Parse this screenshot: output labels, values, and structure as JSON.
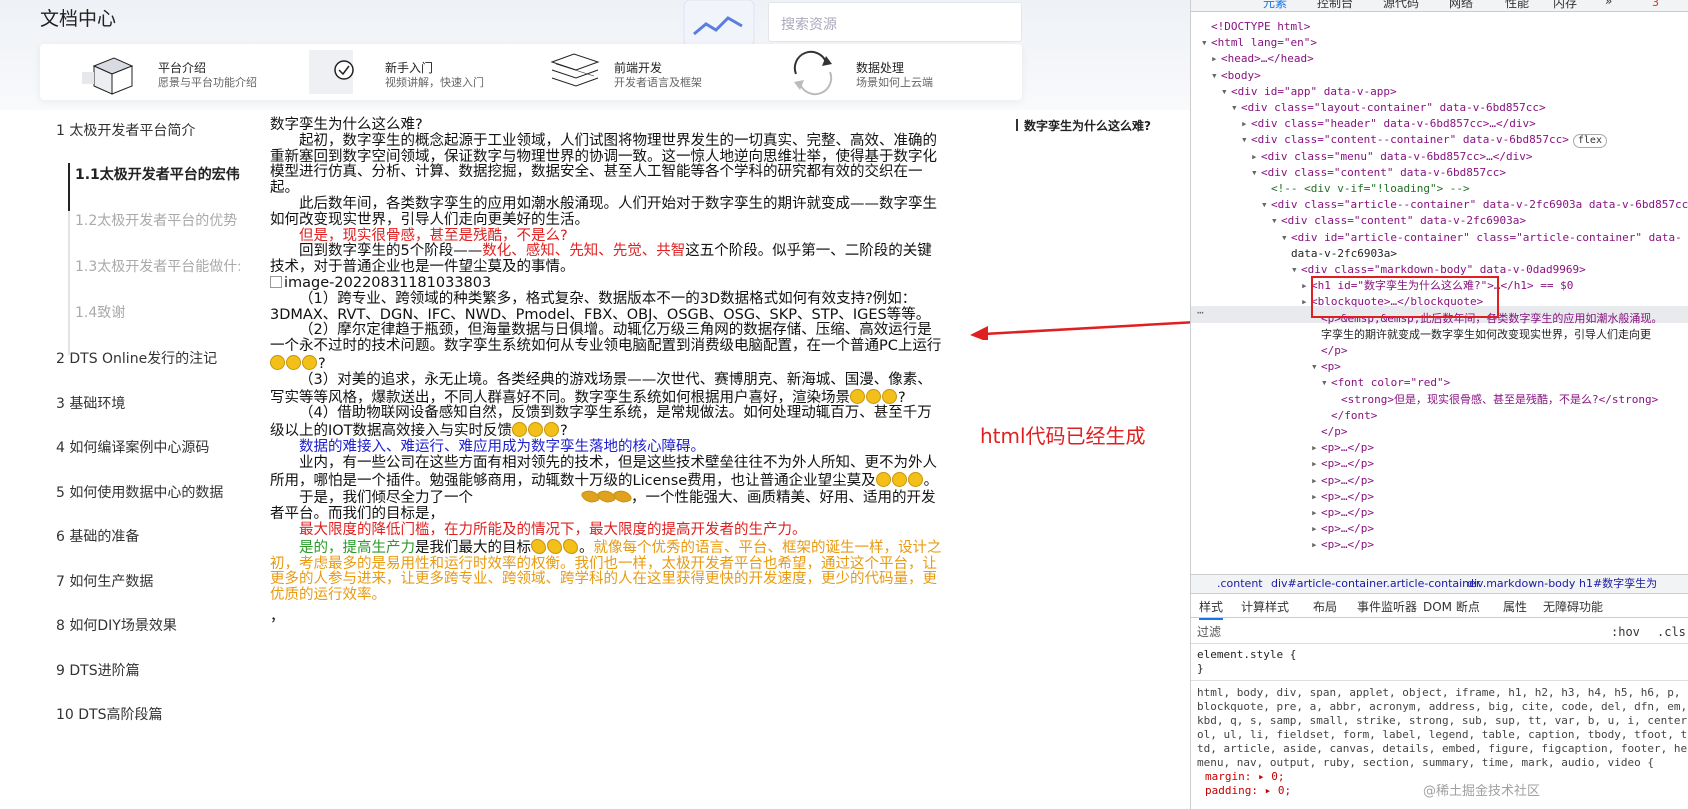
{
  "site": {
    "title": "文档中心",
    "search_placeholder": "搜索资源"
  },
  "cards": [
    {
      "title": "平台介绍",
      "sub": "愿景与平台功能介绍"
    },
    {
      "title": "新手入门",
      "sub": "视频讲解，快速入门"
    },
    {
      "title": "前端开发",
      "sub": "开发者语言及框架"
    },
    {
      "title": "数据处理",
      "sub": "场景如何上云端"
    }
  ],
  "nav": [
    {
      "label": "1 太极开发者平台简介"
    },
    {
      "label": "1.1太极开发者平台的宏伟目标"
    },
    {
      "label": "1.2太极开发者平台的优势"
    },
    {
      "label": "1.3太极开发者平台能做什么"
    },
    {
      "label": "1.4致谢"
    },
    {
      "label": "2 DTS Online发行的注记"
    },
    {
      "label": "3 基础环境"
    },
    {
      "label": "4 如何编译案例中心源码"
    },
    {
      "label": "5 如何使用数据中心的数据"
    },
    {
      "label": "6 基础的准备"
    },
    {
      "label": "7 如何生产数据"
    },
    {
      "label": "8 如何DIY场景效果"
    },
    {
      "label": "9 DTS进阶篇"
    },
    {
      "label": "10 DTS高阶段篇"
    }
  ],
  "article": {
    "heading": "数字孪生为什么这么难?",
    "p1": "起初，数字孪生的概念起源于工业领域，人们试图将物理世界发生的一切真实、完整、高效、准确的重新塞回到数字空间领域，保证数字与物理世界的协调一致。这一惊人地逆向思维壮举，使得基于数字化模型进行仿真、分析、计算、数据挖掘，数据安全、甚至人工智能等各个学科的研究都有效的交织在一起。",
    "p2": "此后数年间，各类数字孪生的应用如潮水般涌现。人们开始对于数字孪生的期许就变成——数字孪生如何改变现实世界，引导人们走向更美好的生活。",
    "p3_red": "但是，现实很骨感，甚至是残酷，不是么?",
    "p4_a": "回到数字孪生的5个阶段——",
    "p4_red": "数化、感知、先知、先觉、共智",
    "p4_b": "这五个阶段。似乎第一、二阶段的关键技术，对于普通企业也是一件望尘莫及的事情。",
    "img_alt": "image-20220831181033803",
    "p5": "（1）跨专业、跨领域的种类繁多，格式复杂、数据版本不一的3D数据格式如何有效支持?例如：3DMAX、RVT、DGN、IFC、NWD、Pmodel、FBX、OBJ、OSGB、OSG、SKP、STP、IGES等等。",
    "p6": "（2）摩尔定律趋于瓶颈，但海量数据与日俱增。动辄亿万级三角网的数据存储、压缩、高效运行是一个永不过时的技术问题。数字孪生系统如何从专业领电脑配置到消费级电脑配置，在一个普通PC上运行",
    "p7": "（3）对美的追求，永无止境。各类经典的游戏场景——次世代、赛博朋克、新海城、国漫、像素、写实等等风格，爆款送出，不同人群喜好不同。数字孪生系统如何根据用户喜好，渲染场景",
    "p8": "（4）借助物联网设备感知自然，反馈到数字孪生系统，是常规做法。如何处理动辄百万、甚至千万级以上的IOT数据高效接入与实时反馈",
    "p9_blue": "数据的难接入、难运行、难应用成为数字孪生落地的核心障碍。",
    "p10": "业内，有一些公司在这些方面有相对领先的技术，但是这些技术壁垒往往不为外人所知、更不为外人所用，哪怕是一个插件。勉强能够商用，动辄数十万级的License费用，也让普通企业望尘莫及",
    "p11_a": "于是，我们倾尽全力了一个",
    "p11_b": "，一个性能强大、画质精美、好用、适用的开发者平台。而我们的目标是，",
    "p12_red": "最大限度的降低门槛，在力所能及的情况下，最大限度的提高开发者的生产力。",
    "p13_green": "是的，提高生产力",
    "p13_b": "是我们最大的目标",
    "p13_orange": "就像每个优秀的语言、平台、框架的诞生一样，设计之初，考虑最多的是易用性和运行时效率的权衡。我们也一样，太极开发者平台也希望，通过这个平台，让更多的人参与进来，让更多跨专业、跨领域、跨学科的人在这里获得更快的开发速度，更少的代码量，更优质的运行效率。",
    "tail": "，"
  },
  "toc_right": "数字孪生为什么这么难?",
  "annotation": "html代码已经生成",
  "devtools": {
    "tabs": [
      "元素",
      "控制台",
      "源代码",
      "网络",
      "性能",
      "内存",
      "»"
    ],
    "error_count": "3",
    "dom": [
      "<!DOCTYPE html>",
      "<html lang=\"en\">",
      "<head>…</head>",
      "<body>",
      "<div id=\"app\" data-v-app>",
      "<div class=\"layout-container\" data-v-6bd857cc>",
      "<div class=\"header\" data-v-6bd857cc>…</div>",
      "<div class=\"content--container\" data-v-6bd857cc>",
      "<div class=\"menu\" data-v-6bd857cc>…</div>",
      "<div class=\"content\" data-v-6bd857cc>",
      "<!-- <div v-if=\"!loading\"> -->",
      "<div class=\"article--container\" data-v-2fc6903a data-v-6bd857cc>",
      "<div class=\"content\" data-v-2fc6903a>",
      "<div id=\"article-container\" class=\"article-container\" data-",
      "data-v-2fc6903a>",
      "<div class=\"markdown-body\" data-v-0dad9969>",
      "<h1 id=\"数字孪生为什么这么难?\">…</h1> == $0",
      "<blockquote>…</blockquote>",
      "<p>&emsp;&emsp;此后数年间，各类数字孪生的应用如潮水般涌现。",
      "字孪生的期许就变成一数字孪生如何改变现实世界，引导人们走向更",
      "</p>",
      "<p>",
      "<font color=\"red\">",
      "<strong>但是，现实很骨感、甚至是残酷，不是么?</strong>",
      "</font>",
      "</p>",
      "<p>…</p>",
      "<p>…</p>",
      "<p>…</p>",
      "<p>…</p>",
      "<p>…</p>",
      "<p>…</p>",
      "<p>…</p>"
    ],
    "flex_badge": "flex",
    "crumbs": [
      ".content",
      "div#article-container.article-container",
      "div.markdown-body",
      "h1#数字孪生为"
    ],
    "sub_tabs": [
      "样式",
      "计算样式",
      "布局",
      "事件监听器",
      "DOM 断点",
      "属性",
      "无障碍功能"
    ],
    "filter_placeholder": "过滤",
    "hov": ":hov",
    "cls": ".cls",
    "styles": [
      "element.style {",
      "}",
      "html, body, div, span, applet, object, iframe, h1, h2, h3, h4, h5, h6, p,",
      "blockquote, pre, a, abbr, acronym, address, big, cite, code, del, dfn, em,",
      "kbd, q, s, samp, small, strike, strong, sub, sup, tt, var, b, u, i, center,",
      "ol, ul, li, fieldset, form, label, legend, table, caption, tbody, tfoot, th",
      "td, article, aside, canvas, details, embed, figure, figcaption, footer, hea",
      "menu, nav, output, ruby, section, summary, time, mark, audio, video {",
      "margin: ▸ 0;",
      "padding: ▸ 0;"
    ],
    "watermark": "@稀土掘金技术社区"
  }
}
